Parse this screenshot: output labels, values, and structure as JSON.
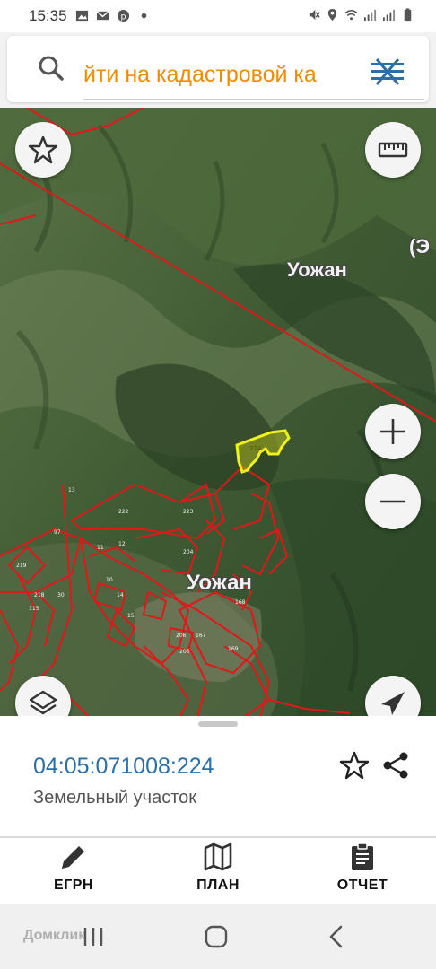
{
  "status_bar": {
    "time": "15:35",
    "left_icons": [
      "gallery-icon",
      "mail-icon",
      "pinterest-icon",
      "dot-icon"
    ],
    "right_icons": [
      "mute-icon",
      "location-icon",
      "wifi-icon",
      "signal-icon",
      "signal-icon",
      "battery-icon"
    ]
  },
  "search": {
    "text": "йти на кадастровой ка",
    "left_icon": "search-icon",
    "right_icon": "layers-menu-icon",
    "text_color": "#f08c00"
  },
  "map": {
    "labels": {
      "river_label": "Уожан",
      "village_label": "Уожан",
      "edge_label": "(Э"
    },
    "selected_parcel_number": "224",
    "parcel_numbers": [
      "222",
      "223",
      "219",
      "10",
      "11",
      "12",
      "97",
      "13",
      "30",
      "14",
      "15",
      "167",
      "168",
      "169",
      "204",
      "206",
      "205",
      "115",
      "218"
    ],
    "buttons": [
      "favorite-icon",
      "ruler-icon",
      "zoom-in-icon",
      "zoom-out-icon",
      "layers-icon",
      "my-location-icon"
    ],
    "colors": {
      "parcel_border": "#e01818",
      "selected_parcel": "#f2f21a"
    }
  },
  "sheet": {
    "cadastral_number": "04:05:071008:224",
    "object_type": "Земельный участок",
    "icons": [
      "star-outline-icon",
      "share-icon"
    ]
  },
  "actions": [
    {
      "label": "ЕГРН",
      "icon": "pencil-icon"
    },
    {
      "label": "ПЛАН",
      "icon": "map-plan-icon"
    },
    {
      "label": "ОТЧЕТ",
      "icon": "clipboard-icon"
    }
  ],
  "navbar": {
    "buttons": [
      "recent-apps-icon",
      "home-icon",
      "back-icon"
    ]
  },
  "watermark": "Домклик"
}
